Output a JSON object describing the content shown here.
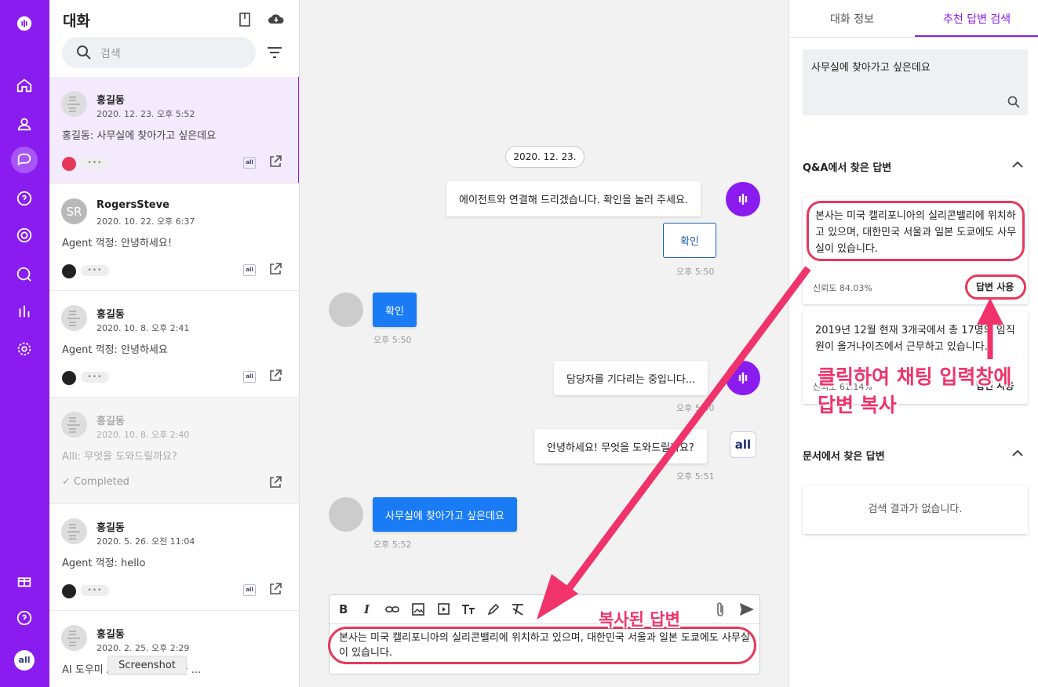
{
  "sidebar": {
    "nav": [
      "home-icon",
      "contacts-icon",
      "chat-icon",
      "help-icon",
      "target-icon",
      "message-search-icon",
      "stats-icon",
      "settings-icon"
    ],
    "bottom": [
      "gift-icon",
      "help-circle-icon"
    ],
    "avatar_text": "all"
  },
  "conversations": {
    "title": "대화",
    "search_placeholder": "검색",
    "items": [
      {
        "name": "홍길동",
        "date": "2020. 12. 23. 오후 5:52",
        "message": "홍길동: 사무실에 찾아가고 싶은데요",
        "status": "active"
      },
      {
        "name": "RogersSteve",
        "initials": "SR",
        "date": "2020. 10. 22. 오후 6:37",
        "message": "Agent 꺽정: 안녕하세요!",
        "status": "normal"
      },
      {
        "name": "홍길동",
        "date": "2020. 10. 8. 오후 2:41",
        "message": "Agent 꺽정: 안녕하세요",
        "status": "normal"
      },
      {
        "name": "홍길동",
        "date": "2020. 10. 8. 오후 2:40",
        "message": "Alli: 무엇을 도와드릴까요?",
        "status": "Completed"
      },
      {
        "name": "홍길동",
        "date": "2020. 5. 26. 오전 11:04",
        "message": "Agent 꺽정: hello",
        "status": "normal"
      },
      {
        "name": "홍길동",
        "date": "2020. 2. 25. 오후 2:29",
        "message": "AI 도우미 Alli 입니다. 무엇을 ...",
        "status": "normal"
      }
    ],
    "tooltip": "Screenshot",
    "mini_logo": "all"
  },
  "chat": {
    "date": "2020. 12. 23.",
    "m1": "에이전트와 연결해 드리겠습니다. 확인을 눌러 주세요.",
    "confirm_btn": "확인",
    "t1": "오후 5:50",
    "m2": "확인",
    "t2": "오후 5:50",
    "m3": "담당자를 기다리는 중입니다...",
    "t3": "오후 5:50",
    "m4": "안녕하세요! 무엇을 도와드릴까요?",
    "t4": "오후 5:51",
    "all_logo": "all",
    "m5": "사무실에 찾아가고 싶은데요",
    "t5": "오후 5:52",
    "toolbar": [
      "B",
      "I",
      "link-icon",
      "image-icon",
      "video-icon",
      "text-size-icon",
      "pen-icon",
      "clear-format-icon"
    ],
    "input": "본사는 미국 캘리포니아의 실리콘밸리에 위치하고 있으며, 대한민국 서울과 일본 도쿄에도 사무실이 있습니다."
  },
  "annotations": {
    "copied": "복사된 답변",
    "click_l1": "클릭하여 채팅 입력창에",
    "click_l2": "답변 복사",
    "color": "#f0336a"
  },
  "right": {
    "tab1": "대화 정보",
    "tab2": "추천 답변 검색",
    "query": "사무실에 찾아가고 싶은데요",
    "qa_title": "Q&A에서 찾은 답변",
    "card1": {
      "text": "본사는 미국 캘리포니아의 실리콘밸리에 위치하고 있으며, 대한민국 서울과 일본 도쿄에도 사무실이 있습니다.",
      "conf": "신뢰도 84.03%",
      "use": "답변 사용"
    },
    "card2": {
      "text": "2019년 12월 현재 3개국에서 총 17명의 임직원이 올거나이즈에서 근무하고 있습니다.",
      "conf": "신뢰도 61.14%",
      "use": "답변 사용"
    },
    "doc_title": "문서에서 찾은 답변",
    "no_result": "검색 결과가 없습니다."
  },
  "colors": {
    "brand": "#8a1cf0",
    "blue": "#1a7cf5",
    "annotation": "#e6395a"
  }
}
